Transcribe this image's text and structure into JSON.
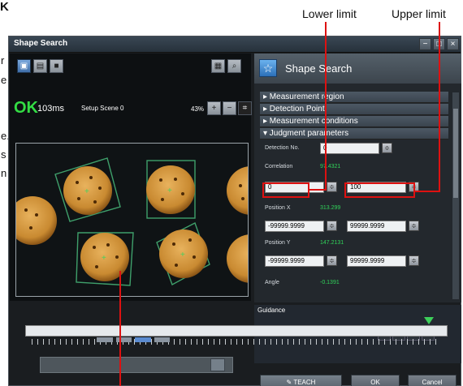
{
  "window": {
    "title": "Shape Search",
    "buttons": [
      "−",
      "□",
      "×"
    ]
  },
  "callouts": {
    "lower": "Lower limit",
    "upper": "Upper limit"
  },
  "left_margin": {
    "chars": [
      "r",
      "e",
      "e.",
      "s",
      "n"
    ],
    "top_letter": "K"
  },
  "left_panel": {
    "status": "OK",
    "time": "103ms",
    "scene": "Setup Scene 0",
    "zoom": "43%"
  },
  "right_panel": {
    "title": "Shape Search",
    "sections": {
      "measurement_region": "▸ Measurement region",
      "detection_point": "▸ Detection Point",
      "measurement_conditions": "▸ Measurement conditions",
      "judgment_parameters": "▾ Judgment parameters"
    },
    "fields": {
      "detection_no": {
        "label": "Detection No.",
        "value": "0"
      },
      "correlation": {
        "label": "Correlation",
        "value": "97.4321",
        "lower": "0",
        "upper": "100"
      },
      "position_x": {
        "label": "Position X",
        "value": "313.299",
        "lower": "-99999.9999",
        "upper": "99999.9999"
      },
      "position_y": {
        "label": "Position Y",
        "value": "147.2131",
        "lower": "-99999.9999",
        "upper": "99999.9999"
      },
      "angle": {
        "label": "Angle",
        "value": "-0.1391"
      }
    }
  },
  "guidance": {
    "title": "Guidance"
  },
  "buttons": {
    "teach": "TEACH",
    "ok": "OK",
    "cancel": "Cancel"
  }
}
